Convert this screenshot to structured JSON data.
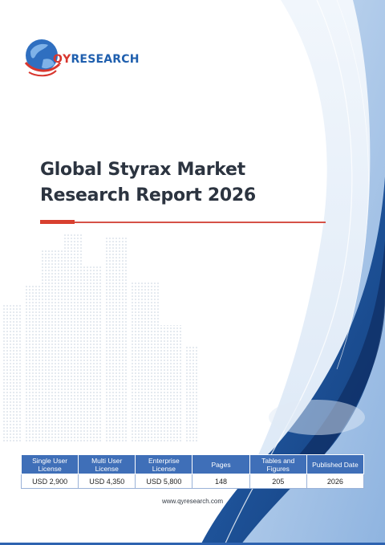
{
  "brand": {
    "logo_q": "Q",
    "logo_y": "Y",
    "logo_rest": "RESEARCH",
    "website": "www.qyresearch.com"
  },
  "report": {
    "title_line1": "Global Styrax Market",
    "title_line2": "Research Report 2026"
  },
  "table": {
    "headers": [
      "Single User License",
      "Multi User License",
      "Enterprise License",
      "Pages",
      "Tables and Figures",
      "Published Date"
    ],
    "values": [
      "USD 2,900",
      "USD 4,350",
      "USD 5,800",
      "148",
      "205",
      "2026"
    ]
  },
  "colors": {
    "accent_red": "#d8402f",
    "brand_blue": "#1f5fae",
    "header_blue": "#3f6fb8",
    "title_gray": "#2c3440"
  }
}
